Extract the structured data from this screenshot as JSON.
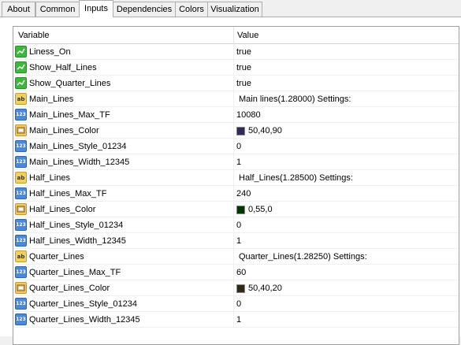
{
  "tabs": [
    {
      "label": "About",
      "active": false
    },
    {
      "label": "Common",
      "active": false
    },
    {
      "label": "Inputs",
      "active": true
    },
    {
      "label": "Dependencies",
      "active": false
    },
    {
      "label": "Colors",
      "active": false
    },
    {
      "label": "Visualization",
      "active": false
    }
  ],
  "grid": {
    "col_variable": "Variable",
    "col_value": "Value",
    "rows": [
      {
        "name": "Liness_On",
        "value": "true",
        "type": "bool"
      },
      {
        "name": "Show_Half_Lines",
        "value": "true",
        "type": "bool"
      },
      {
        "name": "Show_Quarter_Lines",
        "value": "true",
        "type": "bool"
      },
      {
        "name": "Main_Lines",
        "value": "Main lines(1.28000) Settings:",
        "type": "string"
      },
      {
        "name": "Main_Lines_Max_TF",
        "value": "10080",
        "type": "int"
      },
      {
        "name": "Main_Lines_Color",
        "value": "50,40,90",
        "type": "color",
        "swatch": "#32285a"
      },
      {
        "name": "Main_Lines_Style_01234",
        "value": "0",
        "type": "int"
      },
      {
        "name": "Main_Lines_Width_12345",
        "value": "1",
        "type": "int"
      },
      {
        "name": "Half_Lines",
        "value": "Half_Lines(1.28500) Settings:",
        "type": "string"
      },
      {
        "name": "Half_Lines_Max_TF",
        "value": "240",
        "type": "int"
      },
      {
        "name": "Half_Lines_Color",
        "value": "0,55,0",
        "type": "color",
        "swatch": "#003700"
      },
      {
        "name": "Half_Lines_Style_01234",
        "value": "0",
        "type": "int"
      },
      {
        "name": "Half_Lines_Width_12345",
        "value": "1",
        "type": "int"
      },
      {
        "name": "Quarter_Lines",
        "value": "Quarter_Lines(1.28250) Settings:",
        "type": "string"
      },
      {
        "name": "Quarter_Lines_Max_TF",
        "value": "60",
        "type": "int"
      },
      {
        "name": "Quarter_Lines_Color",
        "value": "50,40,20",
        "type": "color",
        "swatch": "#322814"
      },
      {
        "name": "Quarter_Lines_Style_01234",
        "value": "0",
        "type": "int"
      },
      {
        "name": "Quarter_Lines_Width_12345",
        "value": "1",
        "type": "int"
      }
    ]
  }
}
